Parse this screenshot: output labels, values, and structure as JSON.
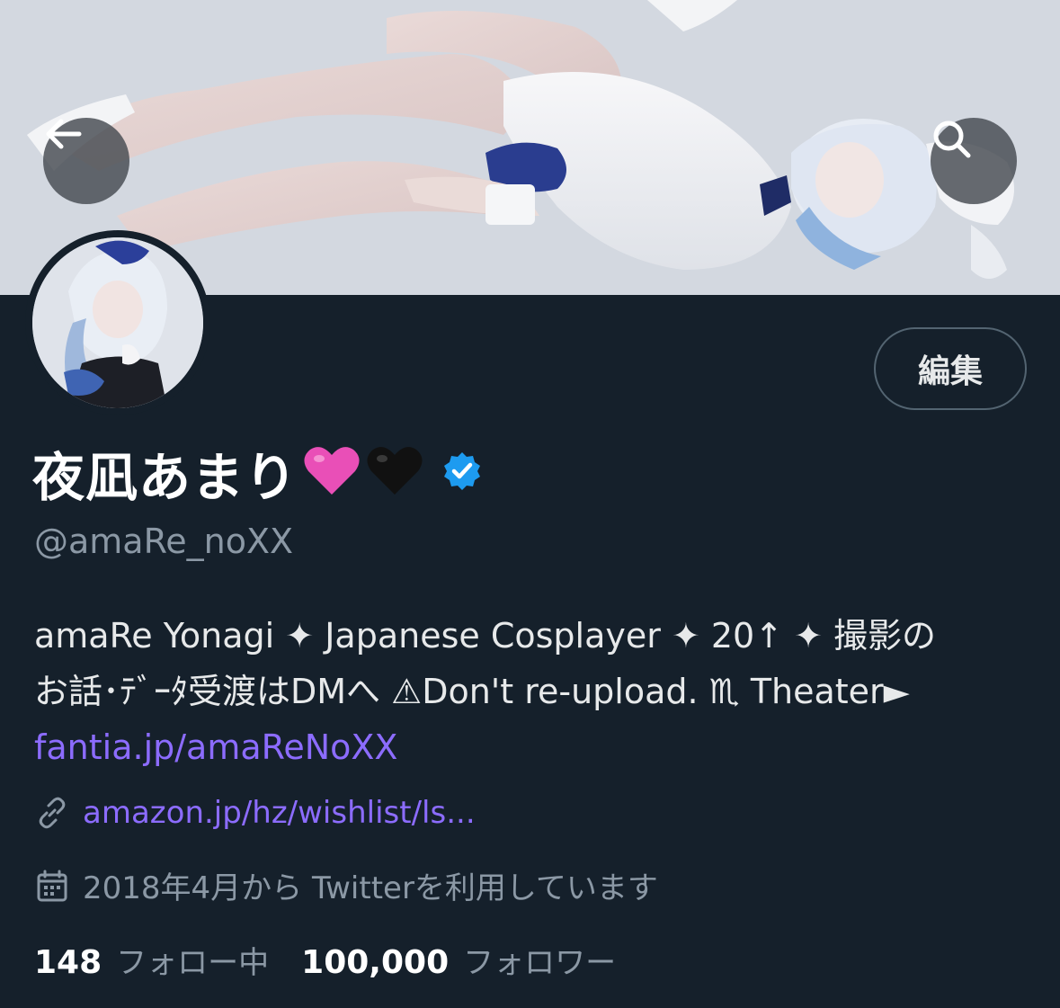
{
  "profile": {
    "display_name": "夜凪あまり",
    "handle": "@amaRe_noXX",
    "edit_label": "編集",
    "bio": {
      "line1": "amaRe Yonagi ✦ Japanese Cosplayer ✦ 20↑ ✦ 撮影の",
      "line2": "お話･ﾃﾞｰﾀ受渡はDMへ ⚠Don't re-upload. ♏ Theater►",
      "link": "fantia.jp/amaReNoXX"
    },
    "website": "amazon.jp/hz/wishlist/ls...",
    "joined": "2018年4月から Twitterを利用しています",
    "following_count": "148",
    "following_label": "フォロー中",
    "followers_count": "100,000",
    "followers_label": "フォロワー"
  },
  "icons": {
    "back": "arrow-left-icon",
    "search": "search-icon",
    "link": "link-icon",
    "calendar": "calendar-icon",
    "verified": "verified-badge-icon",
    "pink_heart": "pink-heart-emoji",
    "black_heart": "black-heart-emoji"
  },
  "colors": {
    "background": "#15202b",
    "link": "#8c6cff",
    "verified": "#1d9bf0",
    "muted": "#8b98a5"
  }
}
